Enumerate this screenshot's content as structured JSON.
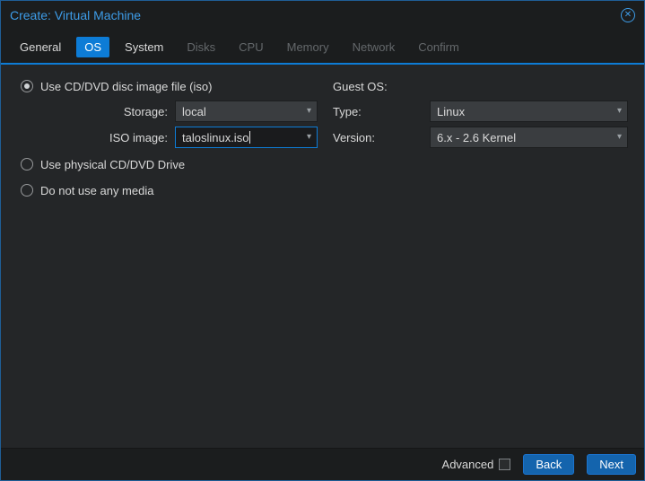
{
  "window": {
    "title": "Create: Virtual Machine"
  },
  "icons": {
    "close": "✕",
    "chevron_down": "▾"
  },
  "tabs": [
    {
      "label": "General"
    },
    {
      "label": "OS",
      "active": true
    },
    {
      "label": "System"
    },
    {
      "label": "Disks",
      "disabled": true
    },
    {
      "label": "CPU",
      "disabled": true
    },
    {
      "label": "Memory",
      "disabled": true
    },
    {
      "label": "Network",
      "disabled": true
    },
    {
      "label": "Confirm",
      "disabled": true
    }
  ],
  "form": {
    "radio_iso_label": "Use CD/DVD disc image file (iso)",
    "radio_iso_selected": true,
    "radio_physical_label": "Use physical CD/DVD Drive",
    "radio_physical_selected": false,
    "radio_none_label": "Do not use any media",
    "radio_none_selected": false,
    "storage_label": "Storage:",
    "storage_value": "local",
    "iso_label": "ISO image:",
    "iso_value": "taloslinux.iso",
    "guest_os_heading": "Guest OS:",
    "type_label": "Type:",
    "type_value": "Linux",
    "version_label": "Version:",
    "version_value": "6.x - 2.6 Kernel"
  },
  "footer": {
    "advanced_label": "Advanced",
    "advanced_checked": false,
    "back_label": "Back",
    "next_label": "Next"
  },
  "colors": {
    "accent_blue": "#0d7cd6",
    "title_blue": "#3d9ce8",
    "button_blue": "#1464ad",
    "content_bg": "#242628",
    "header_bg": "#1b1d1e"
  }
}
